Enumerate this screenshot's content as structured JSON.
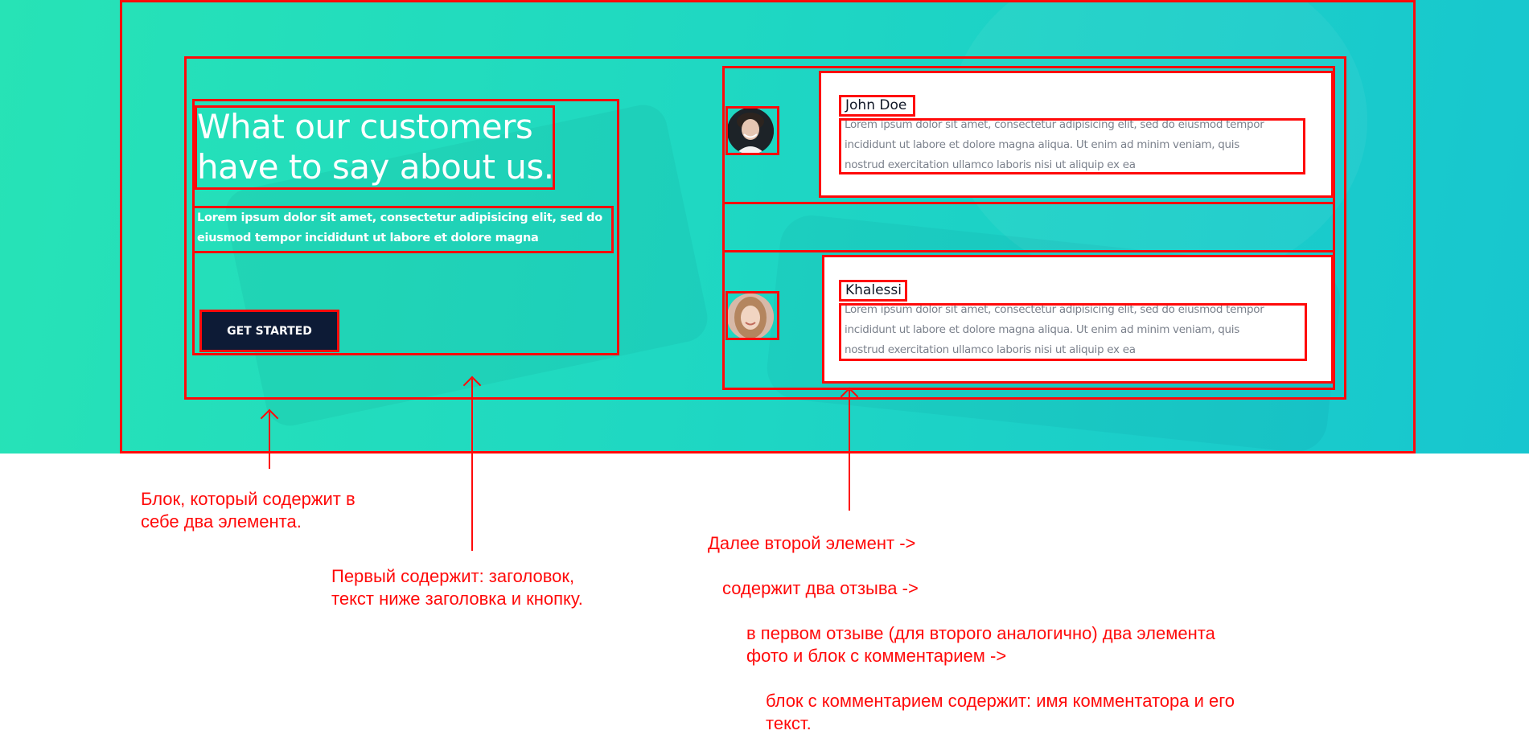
{
  "testimonials_section": {
    "headline": "What our customers have to say about us.",
    "lead": "Lorem ipsum dolor sit amet, consectetur adipisicing elit, sed do eiusmod tempor incididunt ut labore et dolore magna",
    "cta_label": "GET STARTED",
    "reviews": [
      {
        "name": "John Doe",
        "text_lines": [
          "Lorem ipsum dolor sit amet, consectetur adipisicing elit, sed do eiusmod tempor",
          "incididunt ut labore et dolore magna aliqua. Ut enim ad minim veniam, quis",
          "nostrud exercitation ullamco laboris nisi ut aliquip ex ea"
        ]
      },
      {
        "name": "Khalessi",
        "text_lines": [
          "Lorem ipsum dolor sit amet, consectetur adipisicing elit, sed do eiusmod tempor",
          "incididunt ut labore et dolore magna aliqua. Ut enim ad minim veniam, quis",
          "nostrud exercitation ullamco laboris nisi ut aliquip ex ea"
        ]
      }
    ]
  },
  "annotations": {
    "outer_block": [
      "Блок, который содержит в",
      "себе два элемента."
    ],
    "first_element": [
      "Первый содержит: заголовок,",
      "текст ниже заголовка и кнопку."
    ],
    "second_element": "Далее второй элемент ->",
    "two_reviews": "содержит два отзыва ->",
    "review_parts": [
      "в первом отзыве (для второго аналогично) два элемента",
      "фото и блок с комментарием ->"
    ],
    "comment_block": [
      "блок с комментарием содержит: имя комментатора и его",
      "текст."
    ]
  },
  "colors": {
    "gradient_start": "#27e3b6",
    "gradient_end": "#17c6cf",
    "button_bg": "#0d1b36",
    "annotation_red": "#ff0a0a"
  }
}
